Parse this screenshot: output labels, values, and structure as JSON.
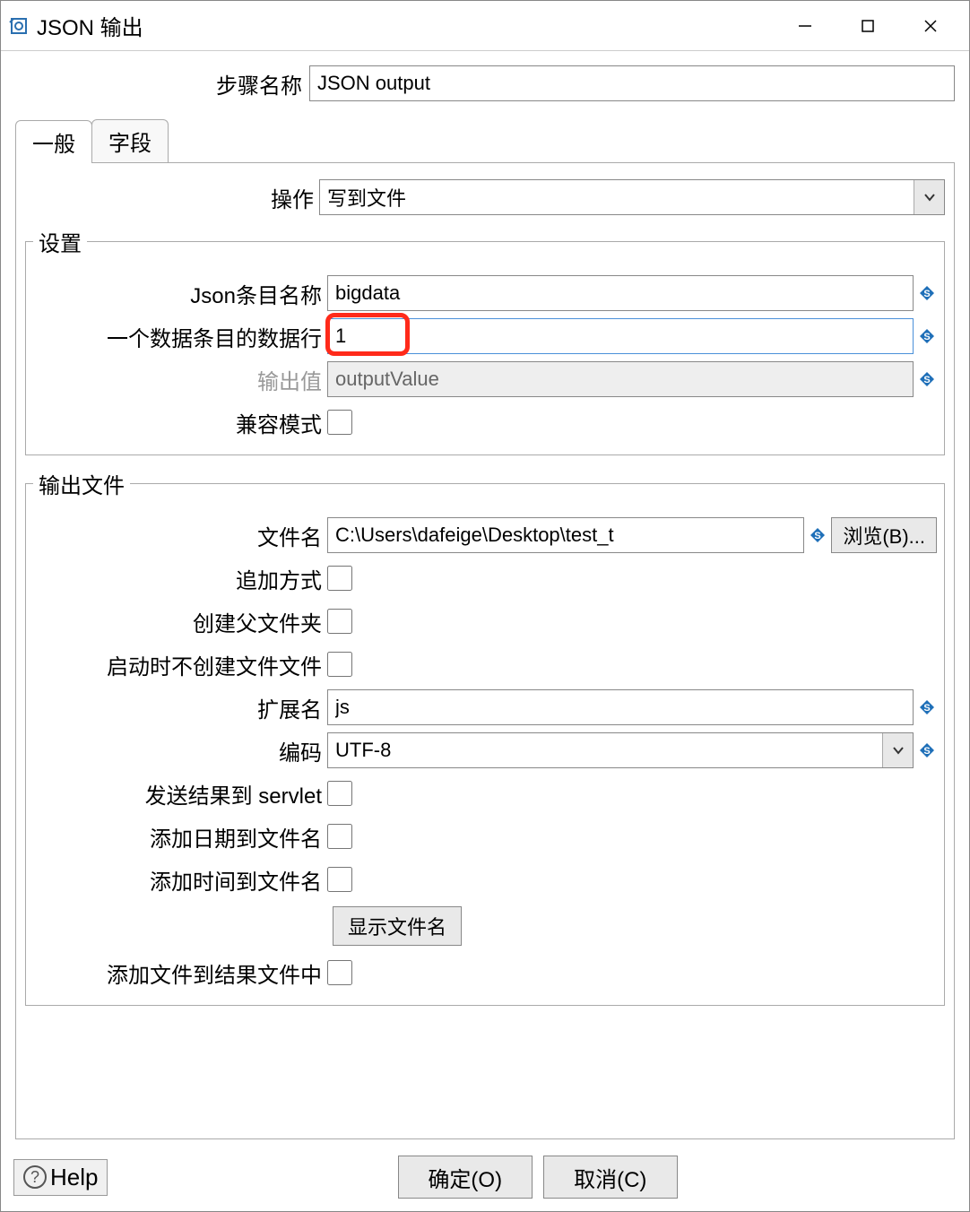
{
  "window": {
    "title": "JSON 输出"
  },
  "step": {
    "label": "步骤名称",
    "value": "JSON output"
  },
  "tabs": {
    "general": "一般",
    "fields": "字段"
  },
  "operation": {
    "label": "操作",
    "value": "写到文件"
  },
  "settings": {
    "legend": "设置",
    "json_entry_label": "Json条目名称",
    "json_entry_value": "bigdata",
    "rows_label": "一个数据条目的数据行",
    "rows_value": "1",
    "output_value_label": "输出值",
    "output_value_value": "outputValue",
    "compat_label": "兼容模式"
  },
  "output_file": {
    "legend": "输出文件",
    "filename_label": "文件名",
    "filename_value": "C:\\Users\\dafeige\\Desktop\\test_t",
    "browse_label": "浏览(B)...",
    "append_label": "追加方式",
    "create_parent_label": "创建父文件夹",
    "no_create_on_start_label": "启动时不创建文件文件",
    "extension_label": "扩展名",
    "extension_value": "js",
    "encoding_label": "编码",
    "encoding_value": "UTF-8",
    "send_servlet_label": "发送结果到 servlet",
    "add_date_label": "添加日期到文件名",
    "add_time_label": "添加时间到文件名",
    "show_filename_btn": "显示文件名",
    "add_to_result_label": "添加文件到结果文件中"
  },
  "buttons": {
    "ok": "确定(O)",
    "cancel": "取消(C)",
    "help": "Help"
  }
}
